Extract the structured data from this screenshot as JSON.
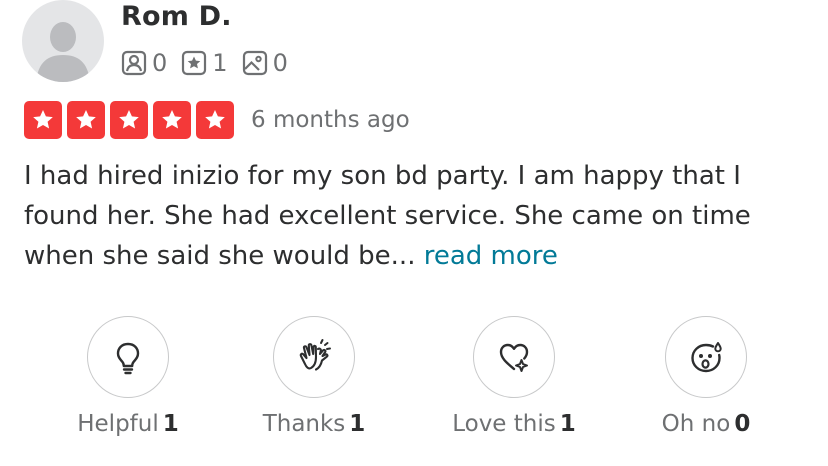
{
  "user": {
    "name": "Rom D.",
    "avatar_icon": "default-user-avatar",
    "stats": [
      {
        "icon": "friends-icon",
        "value": "0"
      },
      {
        "icon": "reviews-icon",
        "value": "1"
      },
      {
        "icon": "photos-icon",
        "value": "0"
      }
    ]
  },
  "review": {
    "rating": 5,
    "rating_max": 5,
    "star_color": "#f43939",
    "date": "6 months ago",
    "text": "I had hired inizio for my son bd party. I am happy that I found her. She had excellent service. She came on time when she said she would be...",
    "read_more": "read more",
    "link_color": "#027a97"
  },
  "reactions": [
    {
      "icon": "lightbulb-icon",
      "label": "Helpful",
      "count": "1"
    },
    {
      "icon": "clapping-hands-icon",
      "label": "Thanks",
      "count": "1"
    },
    {
      "icon": "heart-sparkle-icon",
      "label": "Love this",
      "count": "1"
    },
    {
      "icon": "shocked-face-icon",
      "label": "Oh no",
      "count": "0"
    }
  ]
}
